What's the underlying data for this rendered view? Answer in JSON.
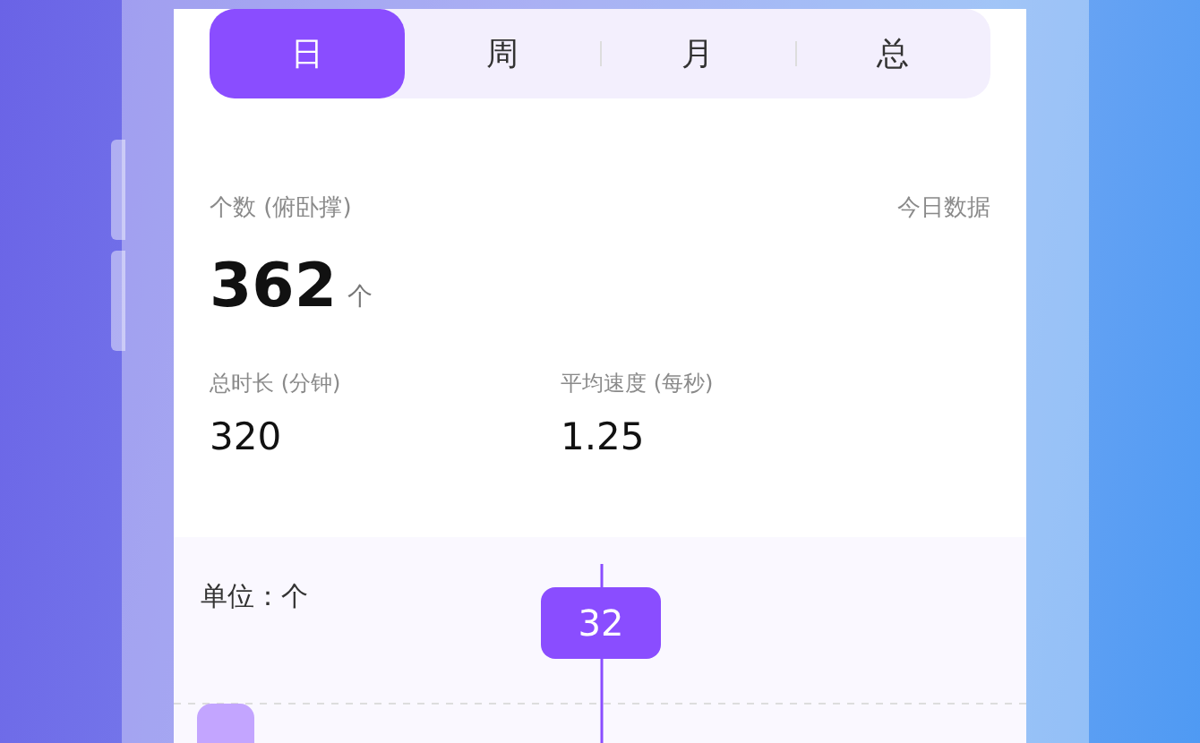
{
  "tabs": [
    {
      "label": "日",
      "selected": true
    },
    {
      "label": "周",
      "selected": false
    },
    {
      "label": "月",
      "selected": false
    },
    {
      "label": "总",
      "selected": false
    }
  ],
  "summary": {
    "label": "个数 (俯卧撑)",
    "scope": "今日数据",
    "value": "362",
    "unit": "个"
  },
  "metrics": [
    {
      "label": "总时长 (分钟)",
      "value": "320"
    },
    {
      "label": "平均速度 (每秒)",
      "value": "1.25"
    }
  ],
  "chart": {
    "unit_label": "单位：个",
    "tooltip": "32"
  }
}
